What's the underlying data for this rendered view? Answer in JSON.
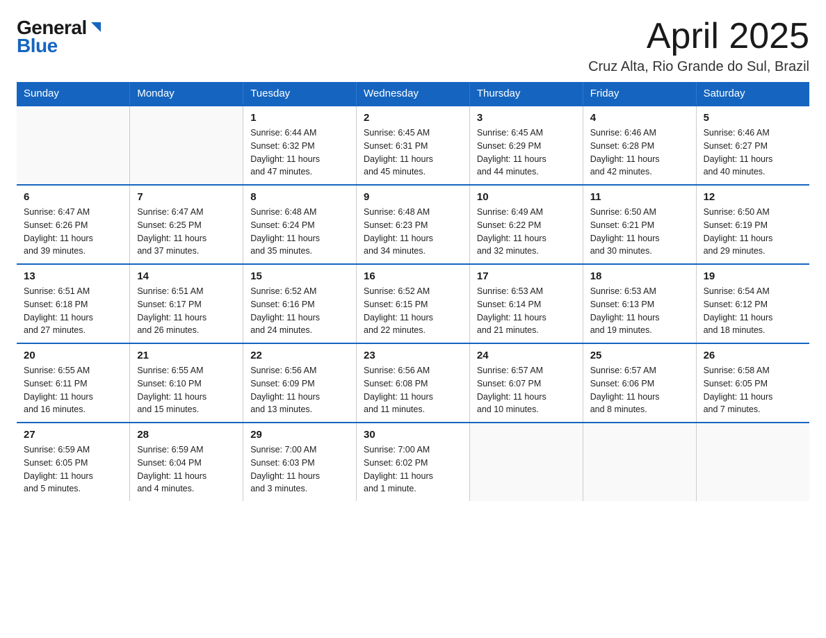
{
  "logo": {
    "general": "General",
    "blue": "Blue"
  },
  "title": "April 2025",
  "subtitle": "Cruz Alta, Rio Grande do Sul, Brazil",
  "weekdays": [
    "Sunday",
    "Monday",
    "Tuesday",
    "Wednesday",
    "Thursday",
    "Friday",
    "Saturday"
  ],
  "weeks": [
    [
      {
        "day": "",
        "info": ""
      },
      {
        "day": "",
        "info": ""
      },
      {
        "day": "1",
        "info": "Sunrise: 6:44 AM\nSunset: 6:32 PM\nDaylight: 11 hours\nand 47 minutes."
      },
      {
        "day": "2",
        "info": "Sunrise: 6:45 AM\nSunset: 6:31 PM\nDaylight: 11 hours\nand 45 minutes."
      },
      {
        "day": "3",
        "info": "Sunrise: 6:45 AM\nSunset: 6:29 PM\nDaylight: 11 hours\nand 44 minutes."
      },
      {
        "day": "4",
        "info": "Sunrise: 6:46 AM\nSunset: 6:28 PM\nDaylight: 11 hours\nand 42 minutes."
      },
      {
        "day": "5",
        "info": "Sunrise: 6:46 AM\nSunset: 6:27 PM\nDaylight: 11 hours\nand 40 minutes."
      }
    ],
    [
      {
        "day": "6",
        "info": "Sunrise: 6:47 AM\nSunset: 6:26 PM\nDaylight: 11 hours\nand 39 minutes."
      },
      {
        "day": "7",
        "info": "Sunrise: 6:47 AM\nSunset: 6:25 PM\nDaylight: 11 hours\nand 37 minutes."
      },
      {
        "day": "8",
        "info": "Sunrise: 6:48 AM\nSunset: 6:24 PM\nDaylight: 11 hours\nand 35 minutes."
      },
      {
        "day": "9",
        "info": "Sunrise: 6:48 AM\nSunset: 6:23 PM\nDaylight: 11 hours\nand 34 minutes."
      },
      {
        "day": "10",
        "info": "Sunrise: 6:49 AM\nSunset: 6:22 PM\nDaylight: 11 hours\nand 32 minutes."
      },
      {
        "day": "11",
        "info": "Sunrise: 6:50 AM\nSunset: 6:21 PM\nDaylight: 11 hours\nand 30 minutes."
      },
      {
        "day": "12",
        "info": "Sunrise: 6:50 AM\nSunset: 6:19 PM\nDaylight: 11 hours\nand 29 minutes."
      }
    ],
    [
      {
        "day": "13",
        "info": "Sunrise: 6:51 AM\nSunset: 6:18 PM\nDaylight: 11 hours\nand 27 minutes."
      },
      {
        "day": "14",
        "info": "Sunrise: 6:51 AM\nSunset: 6:17 PM\nDaylight: 11 hours\nand 26 minutes."
      },
      {
        "day": "15",
        "info": "Sunrise: 6:52 AM\nSunset: 6:16 PM\nDaylight: 11 hours\nand 24 minutes."
      },
      {
        "day": "16",
        "info": "Sunrise: 6:52 AM\nSunset: 6:15 PM\nDaylight: 11 hours\nand 22 minutes."
      },
      {
        "day": "17",
        "info": "Sunrise: 6:53 AM\nSunset: 6:14 PM\nDaylight: 11 hours\nand 21 minutes."
      },
      {
        "day": "18",
        "info": "Sunrise: 6:53 AM\nSunset: 6:13 PM\nDaylight: 11 hours\nand 19 minutes."
      },
      {
        "day": "19",
        "info": "Sunrise: 6:54 AM\nSunset: 6:12 PM\nDaylight: 11 hours\nand 18 minutes."
      }
    ],
    [
      {
        "day": "20",
        "info": "Sunrise: 6:55 AM\nSunset: 6:11 PM\nDaylight: 11 hours\nand 16 minutes."
      },
      {
        "day": "21",
        "info": "Sunrise: 6:55 AM\nSunset: 6:10 PM\nDaylight: 11 hours\nand 15 minutes."
      },
      {
        "day": "22",
        "info": "Sunrise: 6:56 AM\nSunset: 6:09 PM\nDaylight: 11 hours\nand 13 minutes."
      },
      {
        "day": "23",
        "info": "Sunrise: 6:56 AM\nSunset: 6:08 PM\nDaylight: 11 hours\nand 11 minutes."
      },
      {
        "day": "24",
        "info": "Sunrise: 6:57 AM\nSunset: 6:07 PM\nDaylight: 11 hours\nand 10 minutes."
      },
      {
        "day": "25",
        "info": "Sunrise: 6:57 AM\nSunset: 6:06 PM\nDaylight: 11 hours\nand 8 minutes."
      },
      {
        "day": "26",
        "info": "Sunrise: 6:58 AM\nSunset: 6:05 PM\nDaylight: 11 hours\nand 7 minutes."
      }
    ],
    [
      {
        "day": "27",
        "info": "Sunrise: 6:59 AM\nSunset: 6:05 PM\nDaylight: 11 hours\nand 5 minutes."
      },
      {
        "day": "28",
        "info": "Sunrise: 6:59 AM\nSunset: 6:04 PM\nDaylight: 11 hours\nand 4 minutes."
      },
      {
        "day": "29",
        "info": "Sunrise: 7:00 AM\nSunset: 6:03 PM\nDaylight: 11 hours\nand 3 minutes."
      },
      {
        "day": "30",
        "info": "Sunrise: 7:00 AM\nSunset: 6:02 PM\nDaylight: 11 hours\nand 1 minute."
      },
      {
        "day": "",
        "info": ""
      },
      {
        "day": "",
        "info": ""
      },
      {
        "day": "",
        "info": ""
      }
    ]
  ]
}
